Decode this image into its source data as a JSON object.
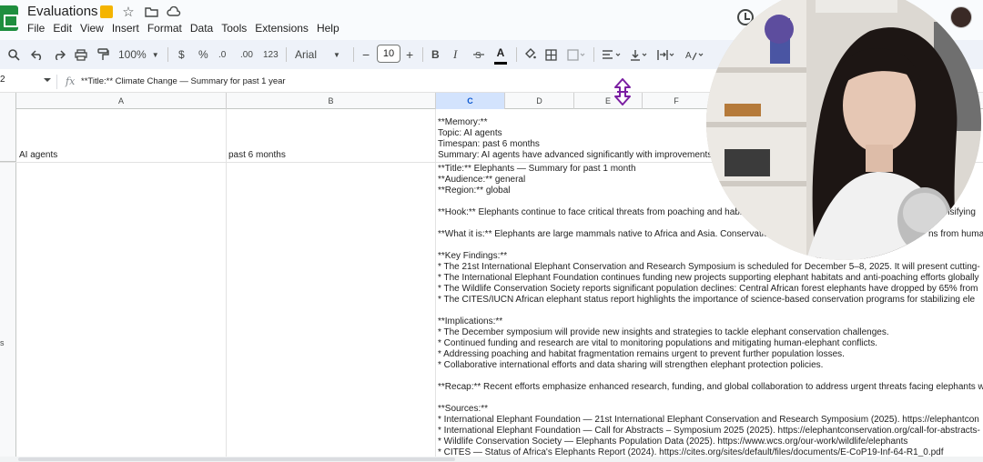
{
  "app": {
    "title": "Evaluations",
    "menu": [
      "File",
      "Edit",
      "View",
      "Insert",
      "Format",
      "Data",
      "Tools",
      "Extensions",
      "Help"
    ]
  },
  "toolbar": {
    "zoom": "100%",
    "currency": "$",
    "percent": "%",
    "decimal_decrease": ".0",
    "decimal_increase": ".00",
    "number_format": "123",
    "font": "Arial",
    "font_size": "10",
    "minus": "−",
    "plus": "+",
    "bold": "B",
    "italic": "I",
    "text_color": "A"
  },
  "formula_bar": {
    "cell_ref": "2",
    "fx": "fx",
    "content": "**Title:** Climate Change — Summary for past 1 year"
  },
  "columns": [
    "A",
    "B",
    "C",
    "D",
    "E",
    "F"
  ],
  "grid": {
    "row1": {
      "a": "AI agents",
      "b": "past 6 months",
      "c_lines": [
        "**Memory:**",
        "Topic: AI agents",
        "Timespan: past 6 months",
        "Summary: AI agents have advanced significantly with improvements"
      ]
    },
    "row2": {
      "c_lines": [
        "**Title:** Elephants — Summary for past 1 month",
        "**Audience:** general",
        "**Region:** global",
        "",
        "**Hook:** Elephants continue to face critical threats from poaching and habit",
        "",
        "**What it is:** Elephants are large mammals native to Africa and Asia. Conservatio",
        "",
        "**Key Findings:**",
        "* The 21st International Elephant Conservation and Research Symposium is scheduled for December 5–8, 2025. It will present cutting-",
        "* The International Elephant Foundation continues funding new projects supporting elephant habitats and anti-poaching efforts globally",
        "* The Wildlife Conservation Society reports significant population declines: Central African forest elephants have dropped by 65% from",
        "* The CITES/IUCN African elephant status report highlights the importance of science-based conservation programs for stabilizing ele",
        "",
        "**Implications:**",
        "* The December symposium will provide new insights and strategies to tackle elephant conservation challenges.",
        "* Continued funding and research are vital to monitoring populations and mitigating human-elephant conflicts.",
        "* Addressing poaching and habitat fragmentation remains urgent to prevent further population losses.",
        "* Collaborative international efforts and data sharing will strengthen elephant protection policies.",
        "",
        "**Recap:** Recent efforts emphasize enhanced research, funding, and global collaboration to address urgent threats facing elephants w",
        "",
        "**Sources:**",
        "* International Elephant Foundation — 21st International Elephant Conservation and Research Symposium (2025). https://elephantcon",
        "* International Elephant Foundation — Call for Abstracts – Symposium 2025 (2025). https://elephantconservation.org/call-for-abstracts-",
        "* Wildlife Conservation Society — Elephants Population Data (2025). https://www.wcs.org/our-work/wildlife/elephants",
        "* CITES — Status of Africa's Elephants Report (2024). https://cites.org/sites/default/files/documents/E-CoP19-Inf-64-R1_0.pdf"
      ]
    },
    "row_marker": "s"
  },
  "overlay_text": {
    "behind_webcam_1": "nsifying",
    "behind_webcam_2": "ns from huma"
  }
}
